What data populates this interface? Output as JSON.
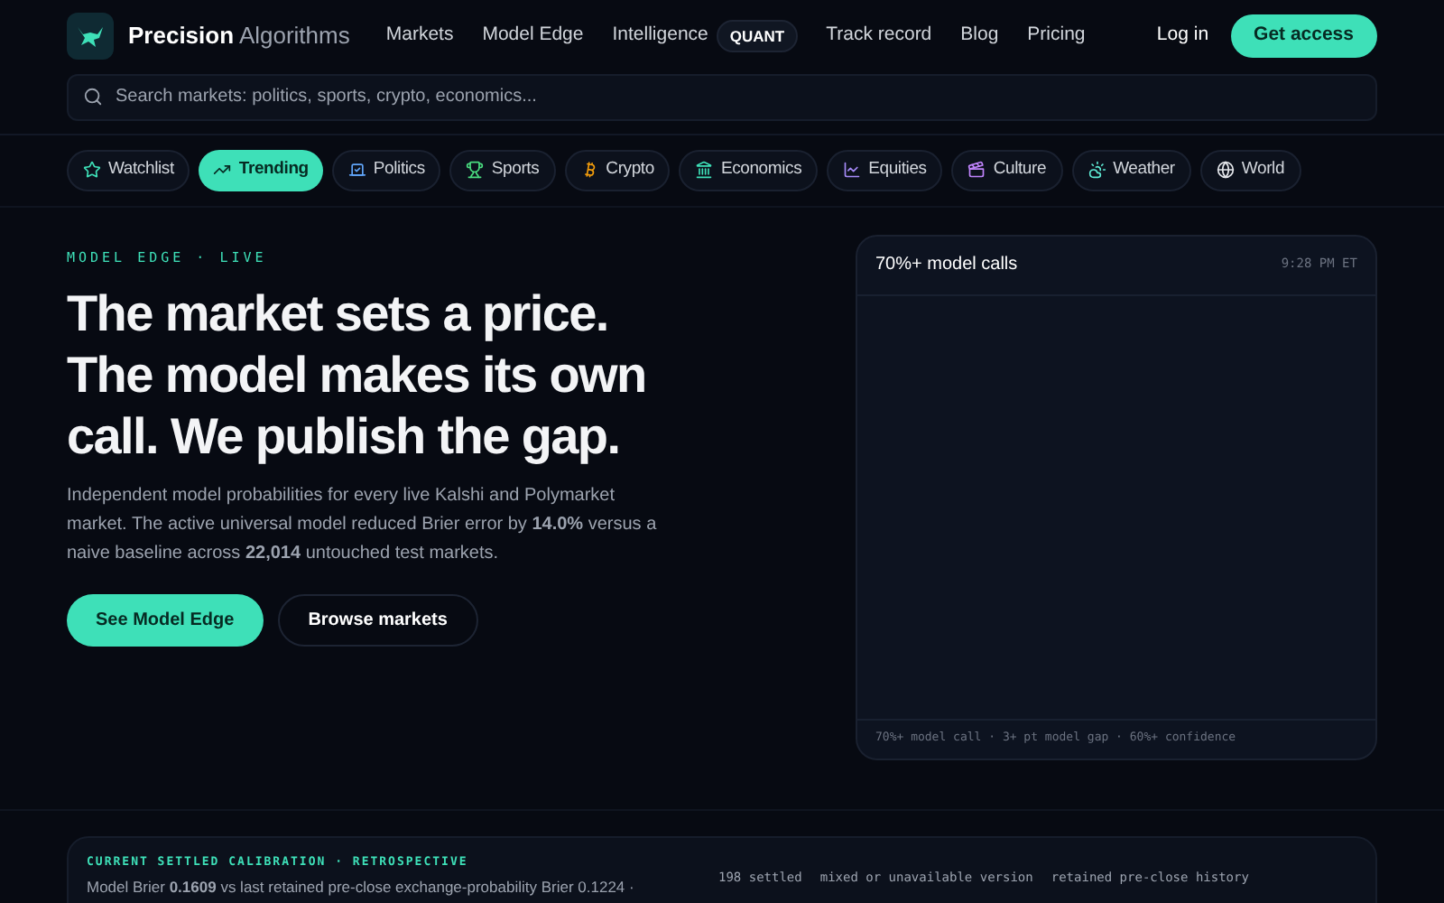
{
  "brand": {
    "name": "Precision",
    "suffix": "Algorithms"
  },
  "nav": [
    {
      "label": "Markets"
    },
    {
      "label": "Model Edge"
    },
    {
      "label": "Intelligence",
      "badge": "QUANT"
    },
    {
      "label": "Track record"
    },
    {
      "label": "Blog"
    },
    {
      "label": "Pricing"
    }
  ],
  "auth": {
    "login": "Log in",
    "cta": "Get access"
  },
  "search": {
    "placeholder": "Search markets: politics, sports, crypto, economics..."
  },
  "categories": [
    {
      "label": "Watchlist",
      "selected": false
    },
    {
      "label": "Trending",
      "selected": true
    },
    {
      "label": "Politics",
      "selected": false
    },
    {
      "label": "Sports",
      "selected": false
    },
    {
      "label": "Crypto",
      "selected": false
    },
    {
      "label": "Economics",
      "selected": false
    },
    {
      "label": "Equities",
      "selected": false
    },
    {
      "label": "Culture",
      "selected": false
    },
    {
      "label": "Weather",
      "selected": false
    },
    {
      "label": "World",
      "selected": false
    }
  ],
  "hero": {
    "eyebrow": "MODEL EDGE · LIVE",
    "heading": [
      "The market sets a price.",
      "The model makes its own",
      "call. We publish the gap."
    ],
    "body": "Independent model probabilities for every live Kalshi and Polymarket market. The active universal model reduced Brier error by **14.0%** versus a naive baseline across **22,014** untouched test markets.",
    "primary": "See Model Edge",
    "secondary": "Browse markets"
  },
  "calls_panel": {
    "title": "70%+ model calls",
    "time": "9:28 PM ET",
    "footer": "70%+ model call · 3+ pt model gap · 60%+ confidence"
  },
  "calibration": {
    "eyebrow": "CURRENT SETTLED CALIBRATION · RETROSPECTIVE",
    "text": "Model Brier **0.1609** vs last retained pre-close exchange-probability Brier 0.1224 ·",
    "stats": [
      "198 settled",
      "mixed or unavailable version",
      "retained pre-close history"
    ]
  }
}
